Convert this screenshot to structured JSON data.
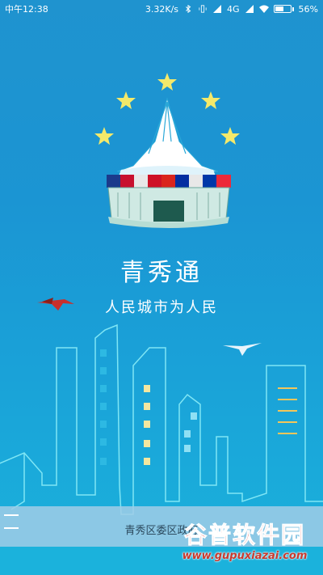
{
  "status_bar": {
    "time": "中午12:38",
    "speed": "3.32K/s",
    "network": "4G",
    "battery": "56%",
    "battery_level": 0.56
  },
  "app": {
    "title": "青秀通",
    "slogan": "人民城市为人民"
  },
  "footer": {
    "org": "青秀区委区政府"
  },
  "watermark": {
    "name": "谷普软件园",
    "url": "www.gupuxiazai.com"
  },
  "colors": {
    "background_top": "#1f93cf",
    "background_bottom": "#1bb2dc",
    "star": "#f4e96a",
    "outline": "#7fe6f5"
  }
}
